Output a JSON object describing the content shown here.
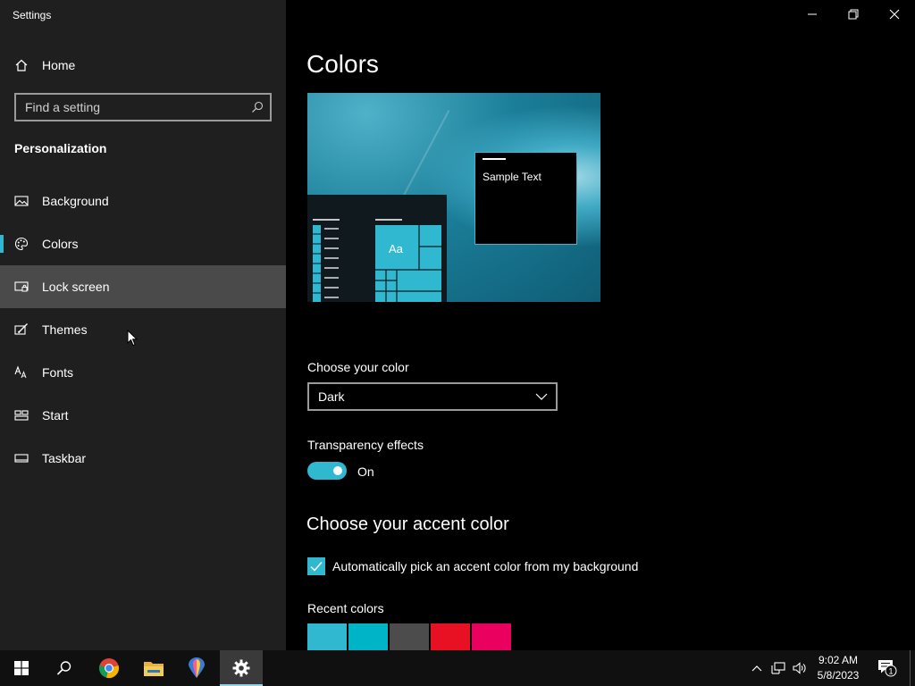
{
  "window": {
    "title": "Settings"
  },
  "sidebar": {
    "home_label": "Home",
    "search_placeholder": "Find a setting",
    "section_title": "Personalization",
    "items": [
      {
        "label": "Background",
        "icon": "picture-icon"
      },
      {
        "label": "Colors",
        "icon": "palette-icon"
      },
      {
        "label": "Lock screen",
        "icon": "lock-screen-icon"
      },
      {
        "label": "Themes",
        "icon": "themes-icon"
      },
      {
        "label": "Fonts",
        "icon": "fonts-icon"
      },
      {
        "label": "Start",
        "icon": "start-icon"
      },
      {
        "label": "Taskbar",
        "icon": "taskbar-icon"
      }
    ]
  },
  "main": {
    "title": "Colors",
    "preview": {
      "sample_text": "Sample Text",
      "tile_text": "Aa"
    },
    "choose_color": {
      "label": "Choose your color",
      "value": "Dark"
    },
    "transparency": {
      "label": "Transparency effects",
      "state": "On"
    },
    "accent": {
      "title": "Choose your accent color",
      "auto_label": "Automatically pick an accent color from my background",
      "auto_checked": true,
      "recent_label": "Recent colors",
      "recent_colors": [
        "#2fb8d0",
        "#00b4c8",
        "#4c4c4c",
        "#e81123",
        "#ea005e"
      ]
    }
  },
  "taskbar": {
    "time": "9:02 AM",
    "date": "5/8/2023",
    "notification_count": "1"
  },
  "colors": {
    "accent": "#2fb8d0",
    "sidebar": "#1f1f1f",
    "background": "#000000"
  }
}
